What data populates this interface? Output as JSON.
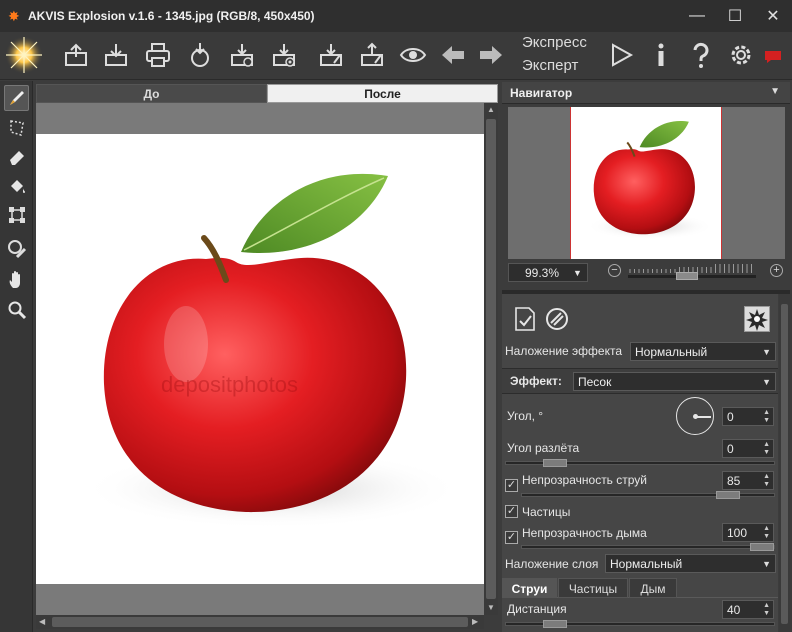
{
  "window": {
    "title": "AKVIS Explosion v.1.6 - 1345.jpg (RGB/8, 450x450)",
    "minimize": "—",
    "maximize": "☐",
    "close": "✕"
  },
  "toolbar": {
    "mode_express": "Экспресс",
    "mode_expert": "Эксперт",
    "icons": [
      "open-icon",
      "save-icon",
      "print-icon",
      "share-icon",
      "batch-icon",
      "preferences-icon",
      "load-preset-icon",
      "save-preset-icon",
      "preview-icon",
      "undo-icon",
      "redo-icon",
      "run-icon",
      "info-icon",
      "help-icon",
      "settings-icon",
      "news-icon"
    ]
  },
  "tools": [
    "brush-icon",
    "selection-icon",
    "eraser-icon",
    "bucket-icon",
    "transform-icon",
    "clone-stamp-icon",
    "hand-icon",
    "zoom-icon"
  ],
  "image_tabs": {
    "before": "До",
    "after": "После"
  },
  "navigator": {
    "title": "Навигатор",
    "zoom": "99.3%",
    "zoom_fraction": 0.45
  },
  "settings": {
    "effect_blend_label": "Наложение эффекта",
    "effect_blend_value": "Нормальный",
    "effect_label": "Эффект:",
    "effect_value": "Песок",
    "angle_label": "Угол, °",
    "angle_value": "0",
    "spread_label": "Угол разлёта",
    "spread_value": "0",
    "spread_fraction": 0.15,
    "jet_opacity_label": "Непрозрачность струй",
    "jet_opacity_value": "85",
    "jet_opacity_checked": true,
    "jet_opacity_fraction": 0.85,
    "particles_label": "Частицы",
    "particles_checked": true,
    "smoke_opacity_label": "Непрозрачность дыма",
    "smoke_opacity_value": "100",
    "smoke_opacity_checked": true,
    "smoke_opacity_fraction": 1.0,
    "layer_blend_label": "Наложение слоя",
    "layer_blend_value": "Нормальный",
    "tabs": [
      "Струи",
      "Частицы",
      "Дым"
    ],
    "distance_label": "Дистанция",
    "distance_value": "40",
    "distance_fraction": 0.15
  },
  "colors": {
    "accent_red": "#d42020",
    "apple_red": "#e41e22",
    "leaf_green": "#5a9a2a"
  }
}
